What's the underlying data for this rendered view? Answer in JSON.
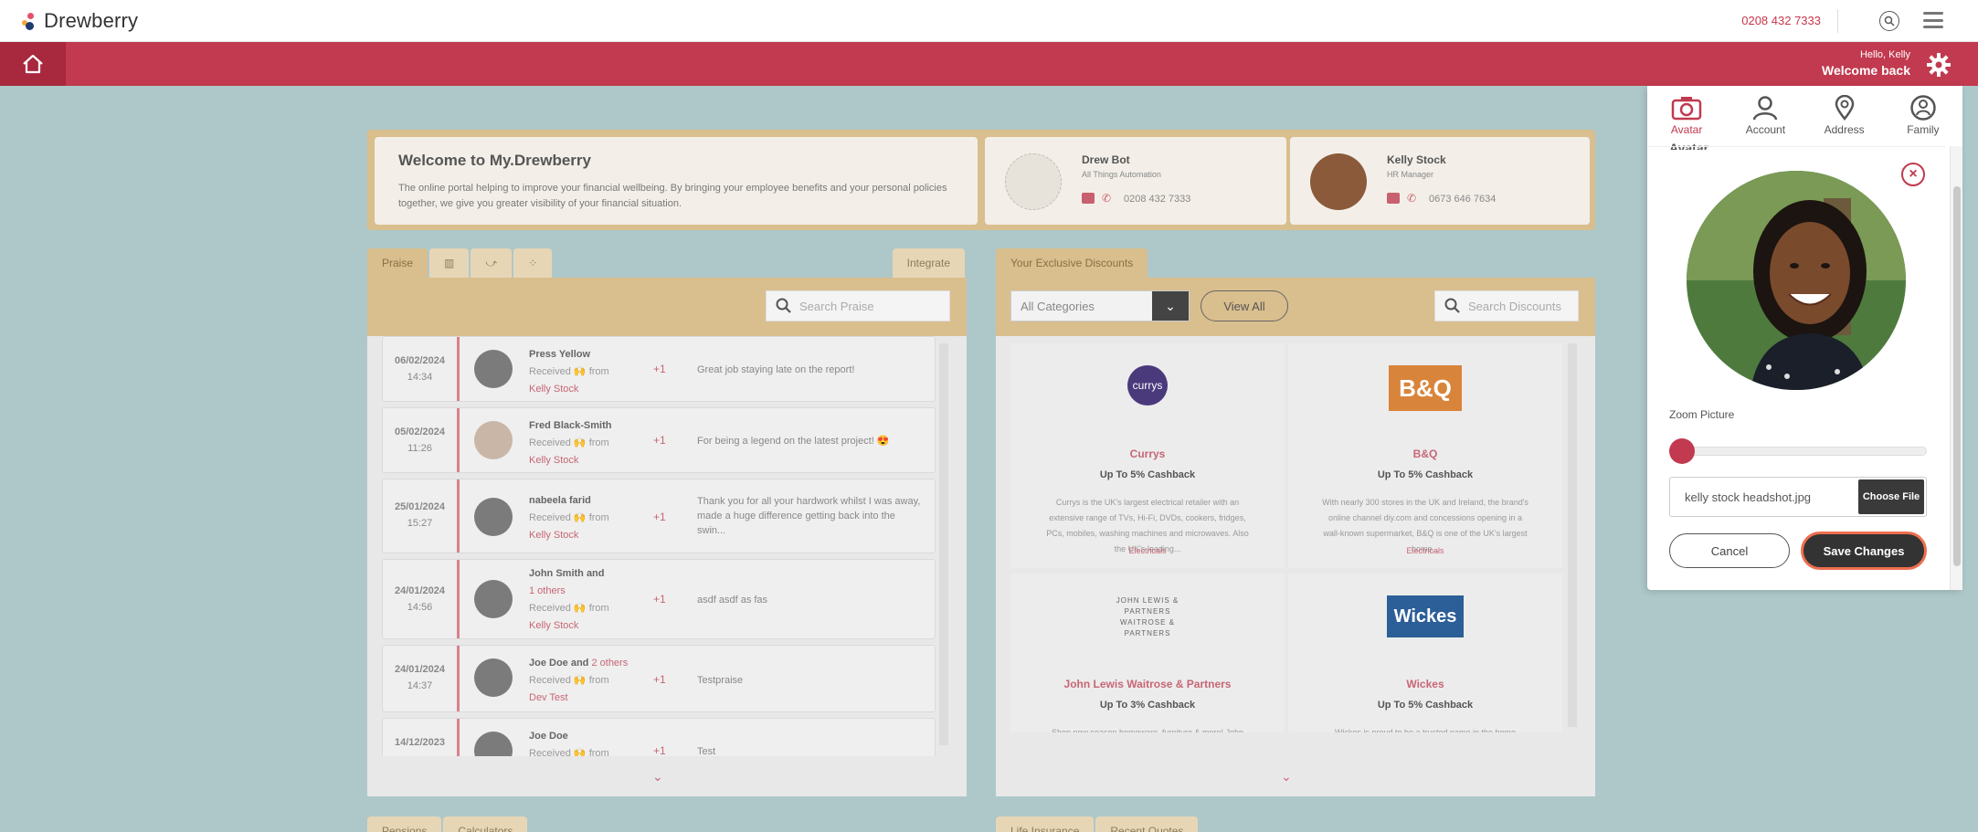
{
  "brand": {
    "name": "Drewberry"
  },
  "header": {
    "phone": "0208 432 7333"
  },
  "user_greeting": {
    "hello": "Hello, Kelly",
    "welcome": "Welcome back"
  },
  "welcome_card": {
    "title": "Welcome to My.Drewberry",
    "body": "The online portal helping to improve your financial wellbeing. By bringing your employee benefits and your personal policies together, we give you greater visibility of your financial situation."
  },
  "contacts": [
    {
      "name": "Drew Bot",
      "role": "All Things Automation",
      "phone": "0208 432 7333"
    },
    {
      "name": "Kelly Stock",
      "role": "HR Manager",
      "phone": "0673 646 7634"
    }
  ],
  "praise": {
    "tab_label": "Praise",
    "integrate_label": "Integrate",
    "search_placeholder": "Search Praise",
    "rows": [
      {
        "date": "06/02/2024",
        "time": "14:34",
        "name": "Press Yellow",
        "received": "Received",
        "from": "from",
        "giver": "Kelly Stock",
        "points": "+1",
        "message": "Great job staying late on the report!"
      },
      {
        "date": "05/02/2024",
        "time": "11:26",
        "name": "Fred Black-Smith",
        "received": "Received",
        "from": "from",
        "giver": "Kelly Stock",
        "points": "+1",
        "message": "For being a legend on the latest project! 😍"
      },
      {
        "date": "25/01/2024",
        "time": "15:27",
        "name": "nabeela farid",
        "received": "Received",
        "from": "from",
        "giver": "Kelly Stock",
        "points": "+1",
        "message": "Thank you for all your hardwork whilst I was away, made a huge difference getting back into the swin..."
      },
      {
        "date": "24/01/2024",
        "time": "14:56",
        "name": "John Smith and",
        "others": "1 others",
        "received": "Received",
        "from": "from",
        "giver": "Kelly Stock",
        "points": "+1",
        "message": "asdf asdf as fas"
      },
      {
        "date": "24/01/2024",
        "time": "14:37",
        "name": "Joe Doe and",
        "others": "2 others",
        "received": "Received",
        "from": "from",
        "giver": "Dev Test",
        "points": "+1",
        "message": "Testpraise"
      },
      {
        "date": "14/12/2023",
        "time": "",
        "name": "Joe Doe",
        "received": "Received",
        "from": "from",
        "giver": "",
        "points": "+1",
        "message": "Test"
      }
    ]
  },
  "discounts": {
    "tab_label": "Your Exclusive Discounts",
    "category_select": "All Categories",
    "view_all": "View All",
    "search_placeholder": "Search Discounts",
    "items": [
      {
        "logo": "currys",
        "brand": "Currys",
        "cashback": "Up To 5% Cashback",
        "desc": "Currys is the UK's largest electrical retailer with an extensive range of TVs, Hi-Fi, DVDs, cookers, fridges, PCs, mobiles, washing machines and microwaves. Also the UK's leading...",
        "category": "Electricals"
      },
      {
        "logo": "B&Q",
        "brand": "B&Q",
        "cashback": "Up To 5% Cashback",
        "desc": "With nearly 300 stores in the UK and Ireland, the brand's online channel diy.com and concessions opening in a wall-known supermarket, B&Q is one of the UK's largest home...",
        "category": "Electricals"
      },
      {
        "logo": "JOHN LEWIS & PARTNERS WAITROSE & PARTNERS",
        "brand": "John Lewis Waitrose & Partners",
        "cashback": "Up To 3% Cashback",
        "desc": "Shop new season homeware, furniture & more! John Lewis is",
        "category": ""
      },
      {
        "logo": "Wickes",
        "brand": "Wickes",
        "cashback": "Up To 5% Cashback",
        "desc": "Wickes is proud to be a trusted name in the home",
        "category": ""
      }
    ]
  },
  "bottom_tabs": {
    "left": [
      "Pensions",
      "Calculators"
    ],
    "right": [
      "Life Insurance",
      "Recent Quotes"
    ]
  },
  "profile_panel": {
    "tabs": [
      "Avatar",
      "Account",
      "Address",
      "Family"
    ],
    "section_title": "Avatar",
    "zoom_label": "Zoom Picture",
    "zoom_value": 0,
    "file_name": "kelly stock headshot.jpg",
    "choose_file": "Choose File",
    "cancel": "Cancel",
    "save": "Save Changes"
  },
  "colors": {
    "brand_red": "#c13a4f",
    "dark_button": "#333333",
    "focus_ring": "#ee6e4e"
  }
}
